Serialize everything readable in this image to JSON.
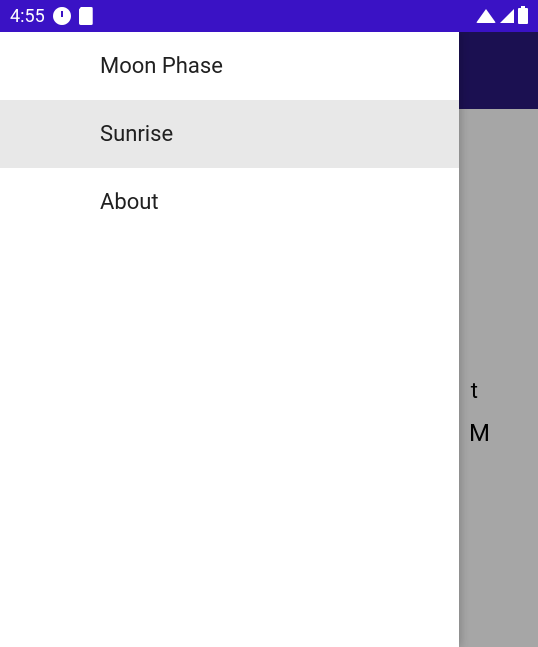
{
  "status": {
    "time": "4:55"
  },
  "drawer": {
    "items": [
      {
        "label": "Moon Phase"
      },
      {
        "label": "Sunrise"
      },
      {
        "label": "About"
      }
    ]
  },
  "content": {
    "label1": "t",
    "label2": "M"
  }
}
